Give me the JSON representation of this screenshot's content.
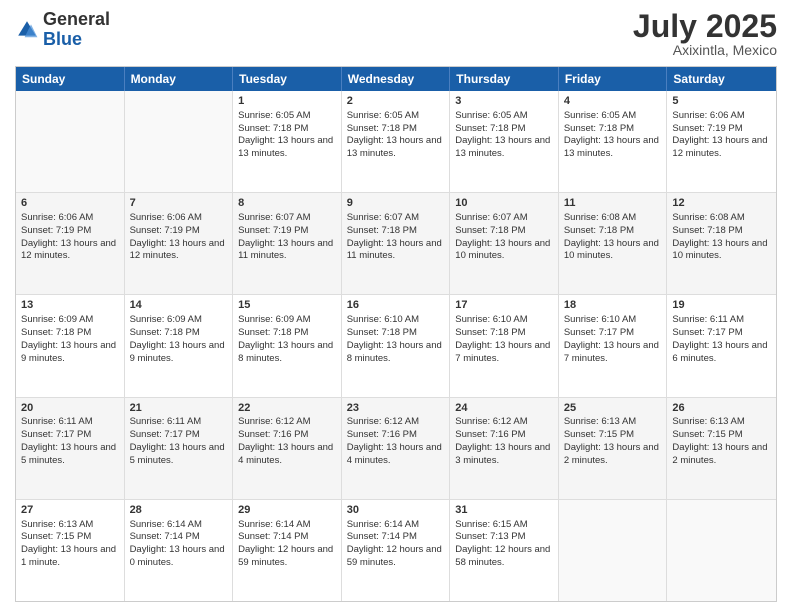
{
  "logo": {
    "line1": "General",
    "line2": "Blue"
  },
  "header": {
    "month": "July 2025",
    "location": "Axixintla, Mexico"
  },
  "days": [
    "Sunday",
    "Monday",
    "Tuesday",
    "Wednesday",
    "Thursday",
    "Friday",
    "Saturday"
  ],
  "rows": [
    [
      {
        "day": "",
        "content": ""
      },
      {
        "day": "",
        "content": ""
      },
      {
        "day": "1",
        "content": "Sunrise: 6:05 AM\nSunset: 7:18 PM\nDaylight: 13 hours and 13 minutes."
      },
      {
        "day": "2",
        "content": "Sunrise: 6:05 AM\nSunset: 7:18 PM\nDaylight: 13 hours and 13 minutes."
      },
      {
        "day": "3",
        "content": "Sunrise: 6:05 AM\nSunset: 7:18 PM\nDaylight: 13 hours and 13 minutes."
      },
      {
        "day": "4",
        "content": "Sunrise: 6:05 AM\nSunset: 7:18 PM\nDaylight: 13 hours and 13 minutes."
      },
      {
        "day": "5",
        "content": "Sunrise: 6:06 AM\nSunset: 7:19 PM\nDaylight: 13 hours and 12 minutes."
      }
    ],
    [
      {
        "day": "6",
        "content": "Sunrise: 6:06 AM\nSunset: 7:19 PM\nDaylight: 13 hours and 12 minutes."
      },
      {
        "day": "7",
        "content": "Sunrise: 6:06 AM\nSunset: 7:19 PM\nDaylight: 13 hours and 12 minutes."
      },
      {
        "day": "8",
        "content": "Sunrise: 6:07 AM\nSunset: 7:19 PM\nDaylight: 13 hours and 11 minutes."
      },
      {
        "day": "9",
        "content": "Sunrise: 6:07 AM\nSunset: 7:18 PM\nDaylight: 13 hours and 11 minutes."
      },
      {
        "day": "10",
        "content": "Sunrise: 6:07 AM\nSunset: 7:18 PM\nDaylight: 13 hours and 10 minutes."
      },
      {
        "day": "11",
        "content": "Sunrise: 6:08 AM\nSunset: 7:18 PM\nDaylight: 13 hours and 10 minutes."
      },
      {
        "day": "12",
        "content": "Sunrise: 6:08 AM\nSunset: 7:18 PM\nDaylight: 13 hours and 10 minutes."
      }
    ],
    [
      {
        "day": "13",
        "content": "Sunrise: 6:09 AM\nSunset: 7:18 PM\nDaylight: 13 hours and 9 minutes."
      },
      {
        "day": "14",
        "content": "Sunrise: 6:09 AM\nSunset: 7:18 PM\nDaylight: 13 hours and 9 minutes."
      },
      {
        "day": "15",
        "content": "Sunrise: 6:09 AM\nSunset: 7:18 PM\nDaylight: 13 hours and 8 minutes."
      },
      {
        "day": "16",
        "content": "Sunrise: 6:10 AM\nSunset: 7:18 PM\nDaylight: 13 hours and 8 minutes."
      },
      {
        "day": "17",
        "content": "Sunrise: 6:10 AM\nSunset: 7:18 PM\nDaylight: 13 hours and 7 minutes."
      },
      {
        "day": "18",
        "content": "Sunrise: 6:10 AM\nSunset: 7:17 PM\nDaylight: 13 hours and 7 minutes."
      },
      {
        "day": "19",
        "content": "Sunrise: 6:11 AM\nSunset: 7:17 PM\nDaylight: 13 hours and 6 minutes."
      }
    ],
    [
      {
        "day": "20",
        "content": "Sunrise: 6:11 AM\nSunset: 7:17 PM\nDaylight: 13 hours and 5 minutes."
      },
      {
        "day": "21",
        "content": "Sunrise: 6:11 AM\nSunset: 7:17 PM\nDaylight: 13 hours and 5 minutes."
      },
      {
        "day": "22",
        "content": "Sunrise: 6:12 AM\nSunset: 7:16 PM\nDaylight: 13 hours and 4 minutes."
      },
      {
        "day": "23",
        "content": "Sunrise: 6:12 AM\nSunset: 7:16 PM\nDaylight: 13 hours and 4 minutes."
      },
      {
        "day": "24",
        "content": "Sunrise: 6:12 AM\nSunset: 7:16 PM\nDaylight: 13 hours and 3 minutes."
      },
      {
        "day": "25",
        "content": "Sunrise: 6:13 AM\nSunset: 7:15 PM\nDaylight: 13 hours and 2 minutes."
      },
      {
        "day": "26",
        "content": "Sunrise: 6:13 AM\nSunset: 7:15 PM\nDaylight: 13 hours and 2 minutes."
      }
    ],
    [
      {
        "day": "27",
        "content": "Sunrise: 6:13 AM\nSunset: 7:15 PM\nDaylight: 13 hours and 1 minute."
      },
      {
        "day": "28",
        "content": "Sunrise: 6:14 AM\nSunset: 7:14 PM\nDaylight: 13 hours and 0 minutes."
      },
      {
        "day": "29",
        "content": "Sunrise: 6:14 AM\nSunset: 7:14 PM\nDaylight: 12 hours and 59 minutes."
      },
      {
        "day": "30",
        "content": "Sunrise: 6:14 AM\nSunset: 7:14 PM\nDaylight: 12 hours and 59 minutes."
      },
      {
        "day": "31",
        "content": "Sunrise: 6:15 AM\nSunset: 7:13 PM\nDaylight: 12 hours and 58 minutes."
      },
      {
        "day": "",
        "content": ""
      },
      {
        "day": "",
        "content": ""
      }
    ]
  ]
}
